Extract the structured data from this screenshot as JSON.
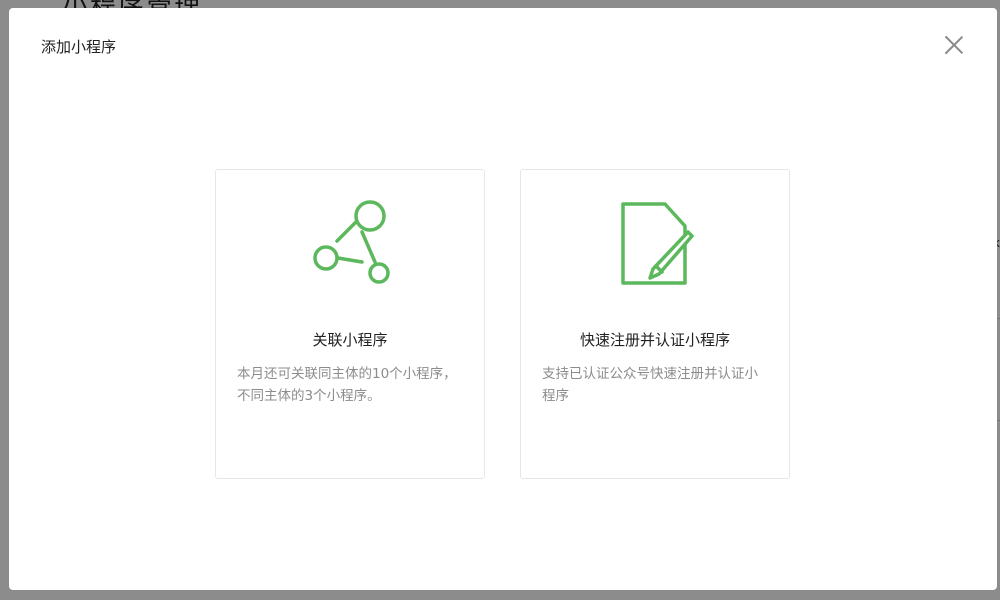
{
  "background": {
    "title": "小程序管理",
    "edge_glyph": "k"
  },
  "modal": {
    "title": "添加小程序",
    "close_icon": "close-icon",
    "accent_color": "#5cb85c"
  },
  "cards": [
    {
      "icon": "network-link-icon",
      "title": "关联小程序",
      "description": "本月还可关联同主体的10个小程序，不同主体的3个小程序。"
    },
    {
      "icon": "document-edit-icon",
      "title": "快速注册并认证小程序",
      "description": "支持已认证公众号快速注册并认证小程序"
    }
  ]
}
